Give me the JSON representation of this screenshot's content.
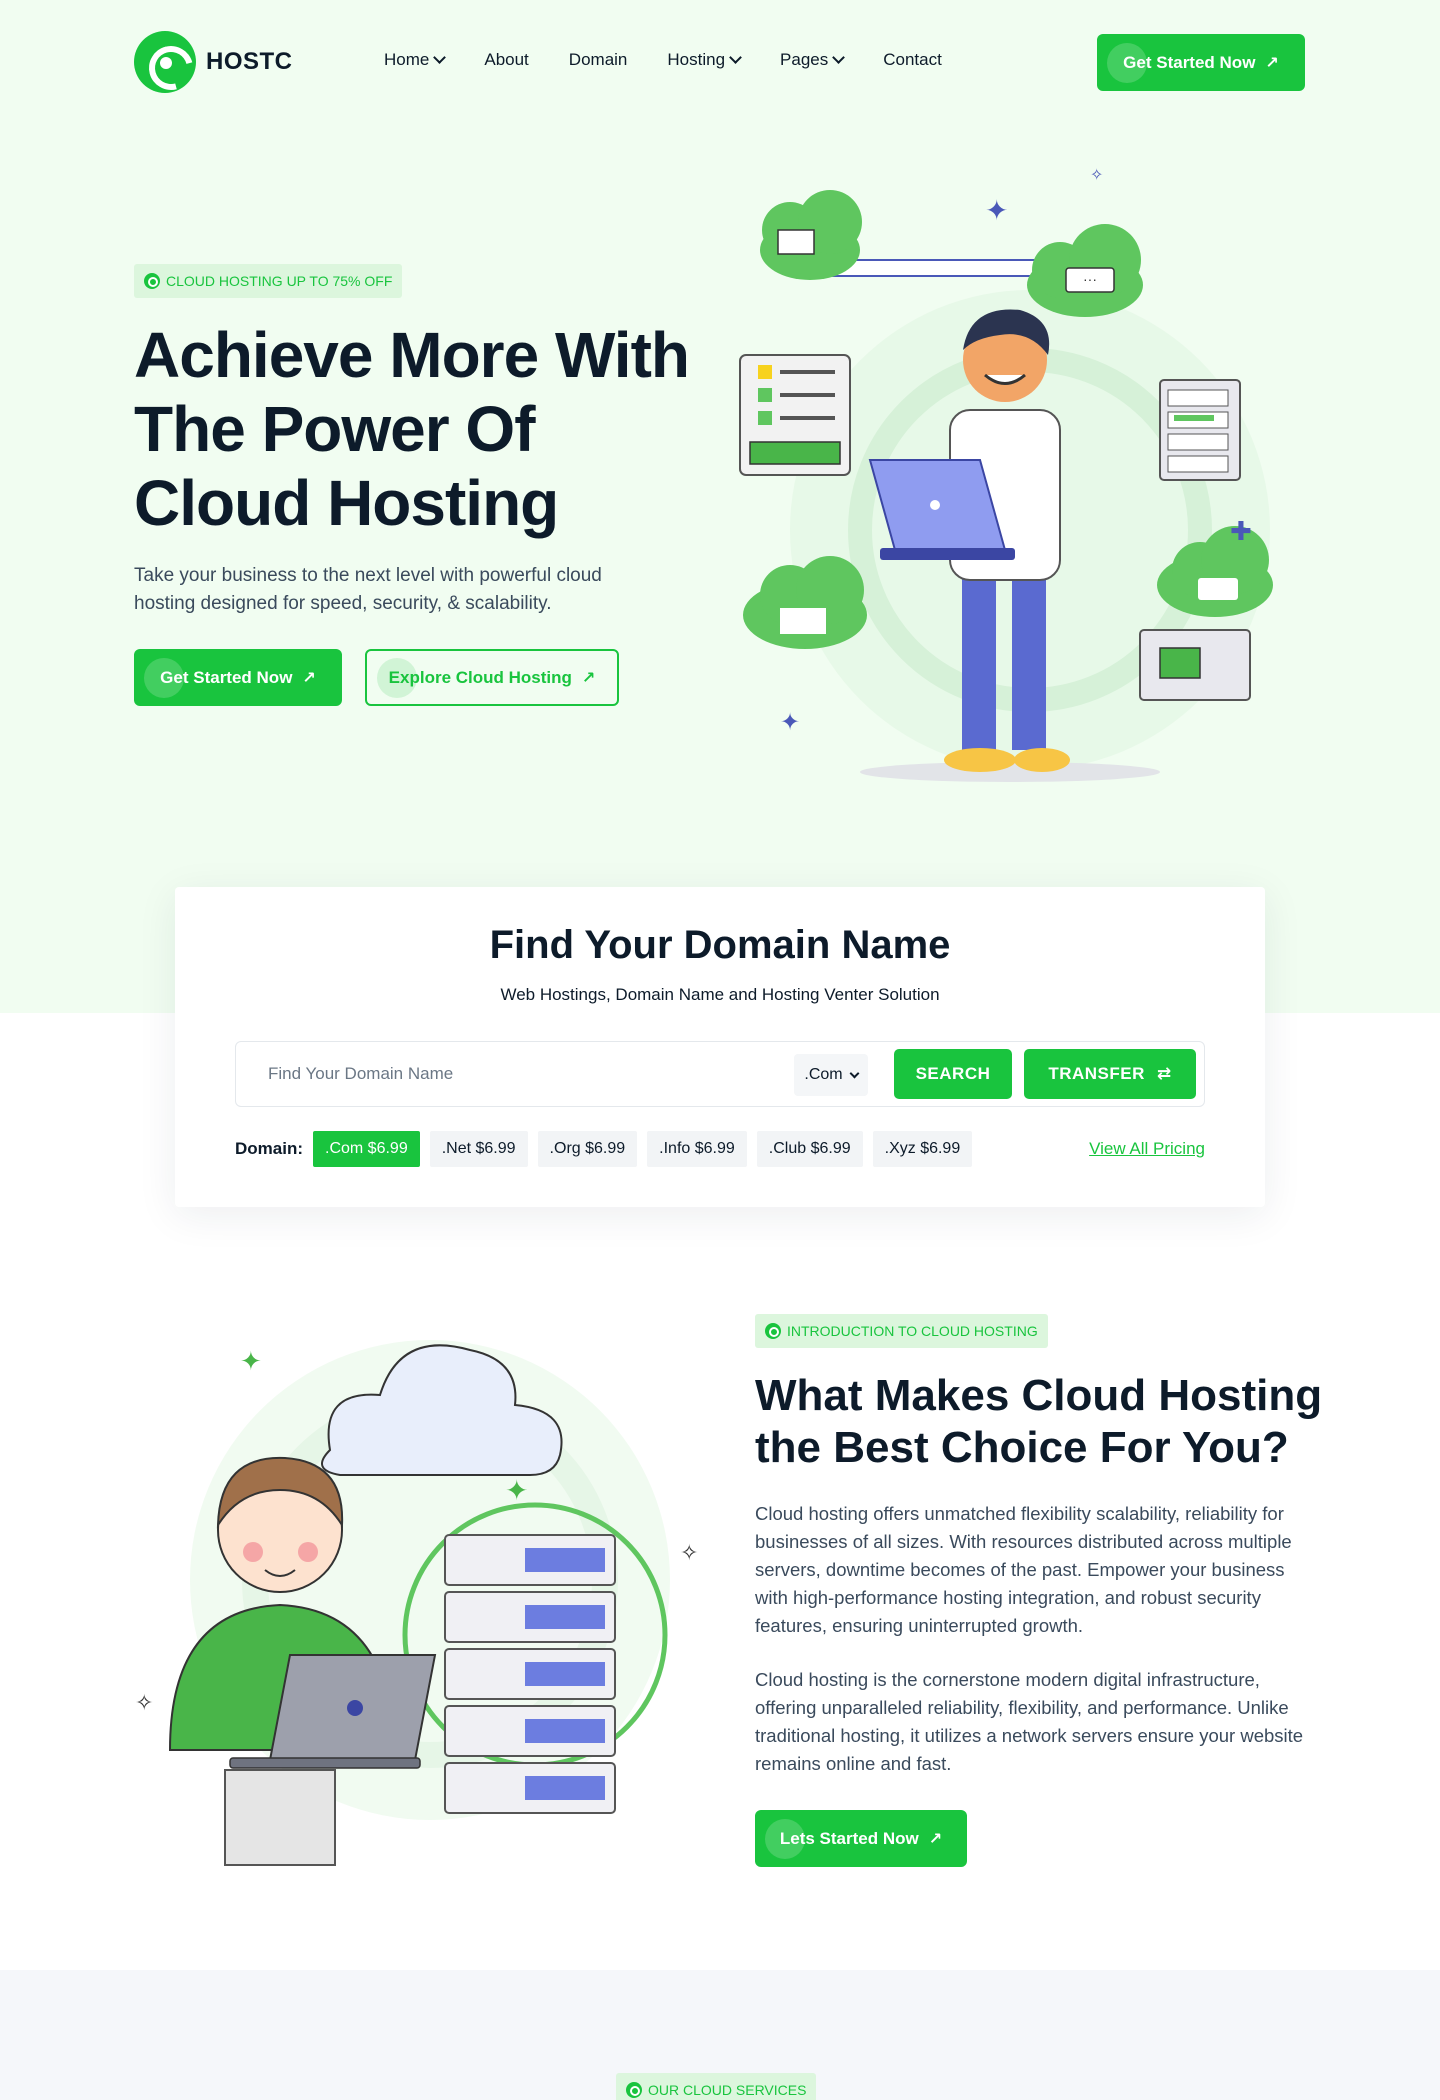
{
  "colors": {
    "accent": "#19c43e",
    "hero_bg": "#f1fdf1",
    "text": "#0d1b2a",
    "muted": "#3a4a5c"
  },
  "header": {
    "logo_text": "HOSTC",
    "nav": [
      {
        "label": "Home",
        "has_dropdown": true
      },
      {
        "label": "About",
        "has_dropdown": false
      },
      {
        "label": "Domain",
        "has_dropdown": false
      },
      {
        "label": "Hosting",
        "has_dropdown": true
      },
      {
        "label": "Pages",
        "has_dropdown": true
      },
      {
        "label": "Contact",
        "has_dropdown": false
      }
    ],
    "cta_label": "Get Started Now"
  },
  "hero": {
    "badge": "CLOUD HOSTING UP TO 75% OFF",
    "title": "Achieve More With The Power Of Cloud Hosting",
    "description": "Take your business to the next level with powerful cloud hosting designed for speed, security, & scalability.",
    "primary_button": "Get Started Now",
    "secondary_button": "Explore Cloud Hosting"
  },
  "domain_search": {
    "title": "Find Your Domain Name",
    "subtitle": "Web Hostings, Domain Name and Hosting Venter Solution",
    "input_placeholder": "Find Your Domain Name",
    "selected_tld": ".Com",
    "search_button": "SEARCH",
    "transfer_button": "TRANSFER",
    "domain_label": "Domain:",
    "tlds": [
      {
        "label": ".Com $6.99",
        "active": true
      },
      {
        "label": ".Net $6.99",
        "active": false
      },
      {
        "label": ".Org $6.99",
        "active": false
      },
      {
        "label": ".Info $6.99",
        "active": false
      },
      {
        "label": ".Club $6.99",
        "active": false
      },
      {
        "label": ".Xyz $6.99",
        "active": false
      }
    ],
    "view_all_link": "View All Pricing"
  },
  "intro": {
    "badge": "INTRODUCTION TO CLOUD HOSTING",
    "title": "What Makes Cloud Hosting the Best Choice For You?",
    "paragraph1": "Cloud hosting offers unmatched flexibility scalability, reliability for businesses of all sizes. With resources distributed across multiple servers, downtime becomes of the past. Empower your business with high-performance hosting integration, and robust security features, ensuring uninterrupted growth.",
    "paragraph2": "Cloud hosting is the cornerstone modern digital infrastructure, offering unparalleled reliability, flexibility, and performance. Unlike traditional hosting, it utilizes a network servers ensure your website remains online and fast.",
    "button": "Lets Started Now"
  },
  "services": {
    "badge": "OUR CLOUD SERVICES"
  }
}
